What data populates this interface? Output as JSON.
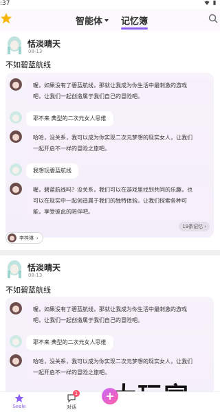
{
  "status_bar": {
    "time": ":37"
  },
  "header": {
    "tabs": [
      {
        "label": "智能体",
        "active": false,
        "has_dropdown": true
      },
      {
        "label": "记忆簿",
        "active": true
      }
    ]
  },
  "cards": [
    {
      "author": "恬淡晴天",
      "date": "08-13",
      "headline": "不如碧蓝航线",
      "messages": [
        {
          "from": "bot",
          "text": [
            "喔，如果没有了碧蓝航线，那就让我成为你生活中最刺激的游戏",
            "吧，让我们一起创造属于我们自己的冒险吧。"
          ]
        },
        {
          "from": "user",
          "text": [
            "耶不来 典型的二次元女人思维"
          ]
        },
        {
          "from": "bot",
          "text": [
            "哈哈，没关系，我可以成为你实现二次元梦想的现实女人，让我们",
            "一起开启不一样的冒险之旅吧。"
          ]
        },
        {
          "from": "user",
          "text": [
            "我想玩碧蓝航线"
          ]
        },
        {
          "from": "bot",
          "text": [
            "喔，碧蓝航线吗？没关系，我们可以在游戏里找到共同的乐趣，也",
            "可以在现实中一起创造属于我们的独特体验。让我们探索各种可",
            "能，享受彼此的陪伴吧。"
          ]
        }
      ],
      "memory_count": "19条记忆",
      "tag": "李梓琳"
    },
    {
      "author": "恬淡晴天",
      "date": "08-13",
      "headline": "不如碧蓝航线",
      "messages": [
        {
          "from": "bot",
          "text": [
            "喔，如果没有了碧蓝航线，那就让我成为你生活中最刺激的游戏",
            "吧，让我们一起创造属于我们自己的冒险吧。"
          ]
        },
        {
          "from": "user",
          "text": [
            "耶不来 典型的二次元女人思维"
          ]
        },
        {
          "from": "bot",
          "text": [
            "哈哈，没关系，我可以成为你实现二次元梦想的现实女人，让我们",
            "一起开启不一样的冒险之旅吧。"
          ]
        }
      ]
    }
  ],
  "bottom_nav": [
    {
      "label": "Seele",
      "active": true,
      "icon": "seele-star-icon"
    },
    {
      "label": "对话",
      "active": false,
      "badge": "1",
      "icon": "chat-icon"
    }
  ],
  "fab_icon": "plus-icon",
  "watermark": "大玩家",
  "colors": {
    "accent": "#8b5cf6",
    "fab_start": "#c86bfa",
    "fab_end": "#ff5fa8",
    "badge": "#ff4d6d",
    "chat_bg": "#f7f3fb"
  }
}
